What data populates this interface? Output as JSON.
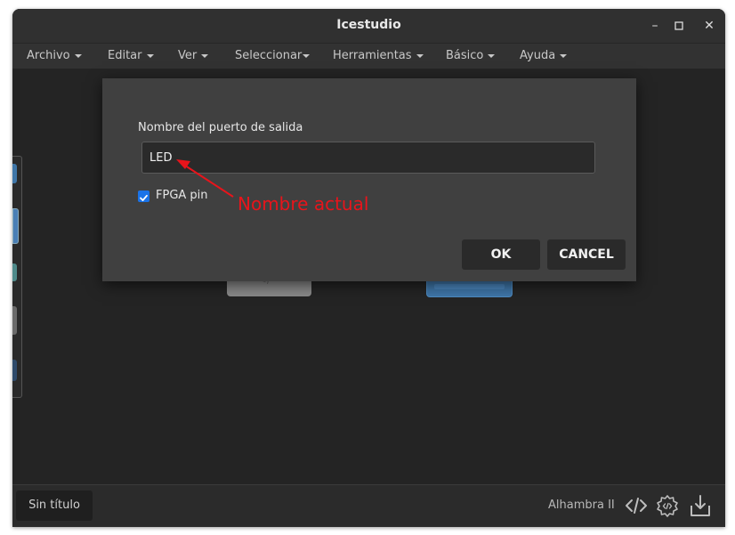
{
  "window": {
    "title": "Icestudio",
    "controls": {
      "minimize": "–",
      "maximize": "☐",
      "close": "✕"
    }
  },
  "menubar": {
    "items": [
      {
        "label": "Archivo"
      },
      {
        "label": "Editar"
      },
      {
        "label": "Ver"
      },
      {
        "label": "Seleccionar"
      },
      {
        "label": "Herramientas"
      },
      {
        "label": "Básico"
      },
      {
        "label": "Ayuda"
      }
    ]
  },
  "dialog": {
    "field_label": "Nombre del puerto de salida",
    "field_value": "LED",
    "checkbox_label": "FPGA pin",
    "checkbox_checked": true,
    "ok_label": "OK",
    "cancel_label": "CANCEL"
  },
  "annotation": {
    "text": "Nombre actual",
    "color": "#e8141b"
  },
  "bottombar": {
    "filename": "Sin título",
    "board": "Alhambra II",
    "icons": [
      "code-icon",
      "settings-gear-icon",
      "download-icon"
    ]
  },
  "colors": {
    "accent": "#1a73e8",
    "canvas": "#242424",
    "dialog": "#404040"
  }
}
